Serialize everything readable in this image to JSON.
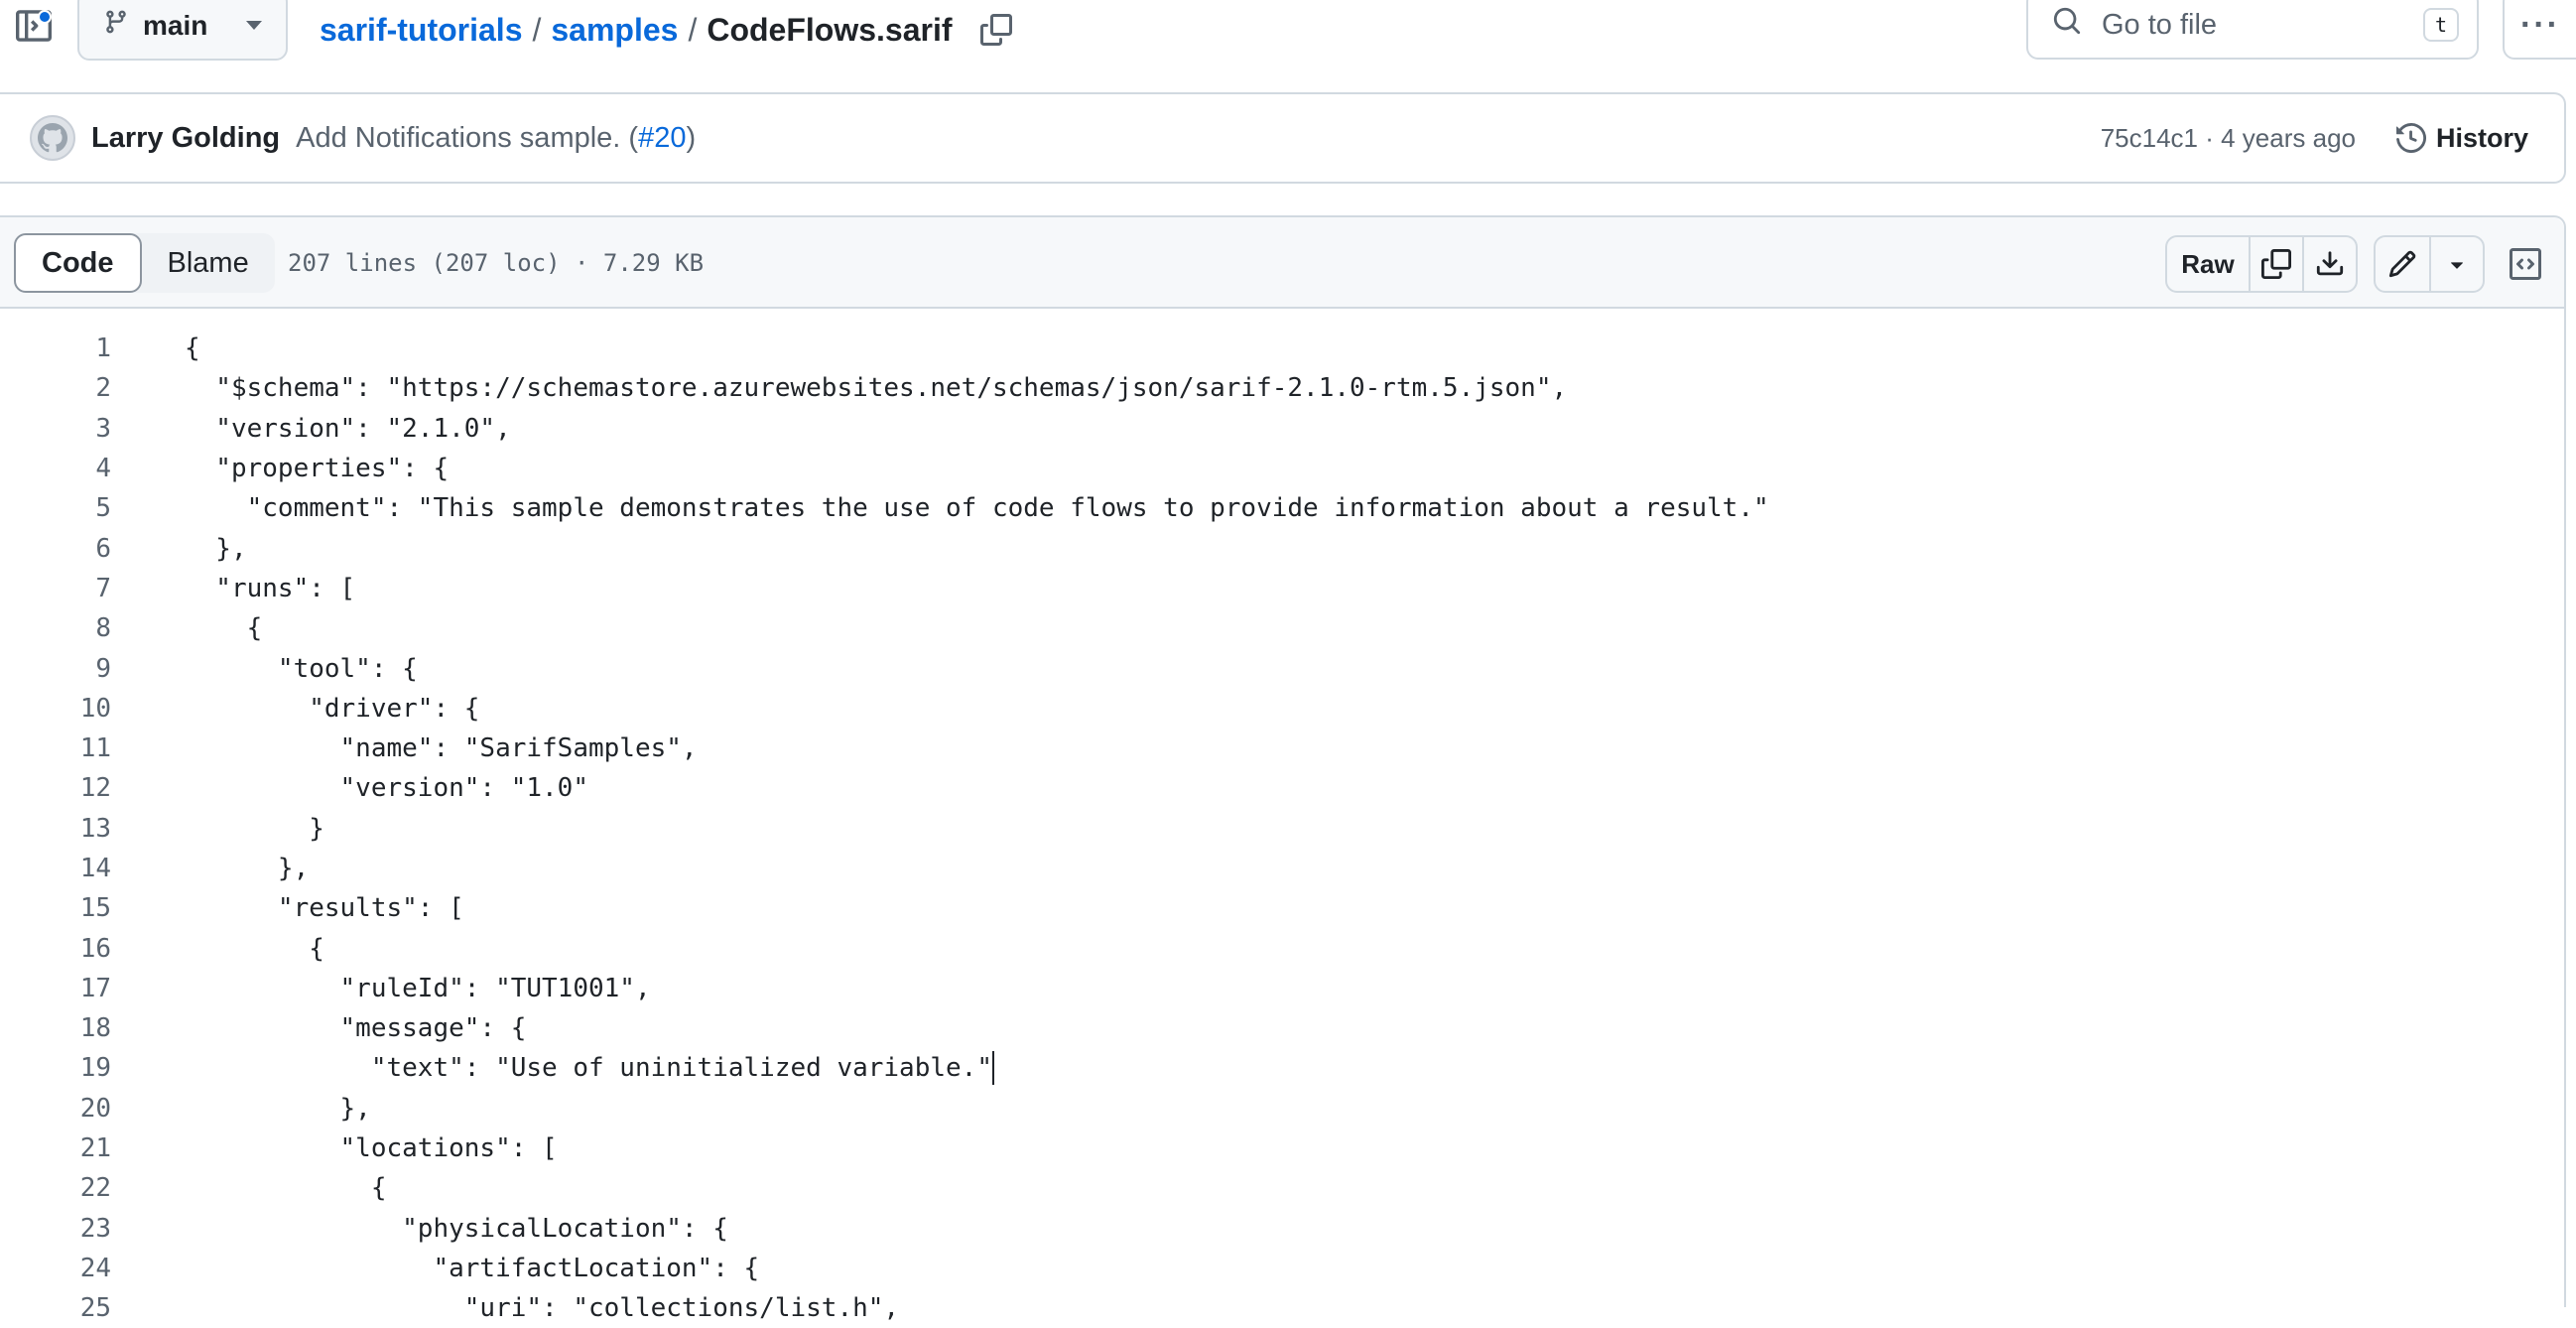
{
  "topbar": {
    "branch": "main",
    "breadcrumb": {
      "repo": "sarif-tutorials",
      "sep1": "/",
      "folder": "samples",
      "sep2": "/",
      "file": "CodeFlows.sarif"
    },
    "search": {
      "placeholder": "Go to file",
      "shortcut": "t"
    },
    "more_label": "···"
  },
  "commit": {
    "author": "Larry Golding",
    "message": "Add Notifications sample. (",
    "pr_link": "#20",
    "message_end": ")",
    "meta": "75c14c1 · 4 years ago",
    "history_label": "History"
  },
  "file_header": {
    "tabs": [
      "Code",
      "Blame"
    ],
    "active_tab": "Code",
    "info": "207 lines (207 loc) · 7.29 KB",
    "raw_label": "Raw"
  },
  "code": {
    "lines": [
      {
        "n": "1",
        "t": "{"
      },
      {
        "n": "2",
        "t": "  \"$schema\": \"https://schemastore.azurewebsites.net/schemas/json/sarif-2.1.0-rtm.5.json\","
      },
      {
        "n": "3",
        "t": "  \"version\": \"2.1.0\","
      },
      {
        "n": "4",
        "t": "  \"properties\": {"
      },
      {
        "n": "5",
        "t": "    \"comment\": \"This sample demonstrates the use of code flows to provide information about a result.\""
      },
      {
        "n": "6",
        "t": "  },"
      },
      {
        "n": "7",
        "t": "  \"runs\": ["
      },
      {
        "n": "8",
        "t": "    {"
      },
      {
        "n": "9",
        "t": "      \"tool\": {"
      },
      {
        "n": "10",
        "t": "        \"driver\": {"
      },
      {
        "n": "11",
        "t": "          \"name\": \"SarifSamples\","
      },
      {
        "n": "12",
        "t": "          \"version\": \"1.0\""
      },
      {
        "n": "13",
        "t": "        }"
      },
      {
        "n": "14",
        "t": "      },"
      },
      {
        "n": "15",
        "t": "      \"results\": ["
      },
      {
        "n": "16",
        "t": "        {"
      },
      {
        "n": "17",
        "t": "          \"ruleId\": \"TUT1001\","
      },
      {
        "n": "18",
        "t": "          \"message\": {"
      },
      {
        "n": "19",
        "t": "            \"text\": \"Use of uninitialized variable.\""
      },
      {
        "n": "20",
        "t": "          },"
      },
      {
        "n": "21",
        "t": "          \"locations\": ["
      },
      {
        "n": "22",
        "t": "            {"
      },
      {
        "n": "23",
        "t": "              \"physicalLocation\": {"
      },
      {
        "n": "24",
        "t": "                \"artifactLocation\": {"
      },
      {
        "n": "25",
        "t": "                  \"uri\": \"collections/list.h\","
      }
    ]
  },
  "colors": {
    "link": "#0969da",
    "muted": "#59636e",
    "border": "#d1d9e0",
    "header_bg": "#f6f8fa"
  }
}
